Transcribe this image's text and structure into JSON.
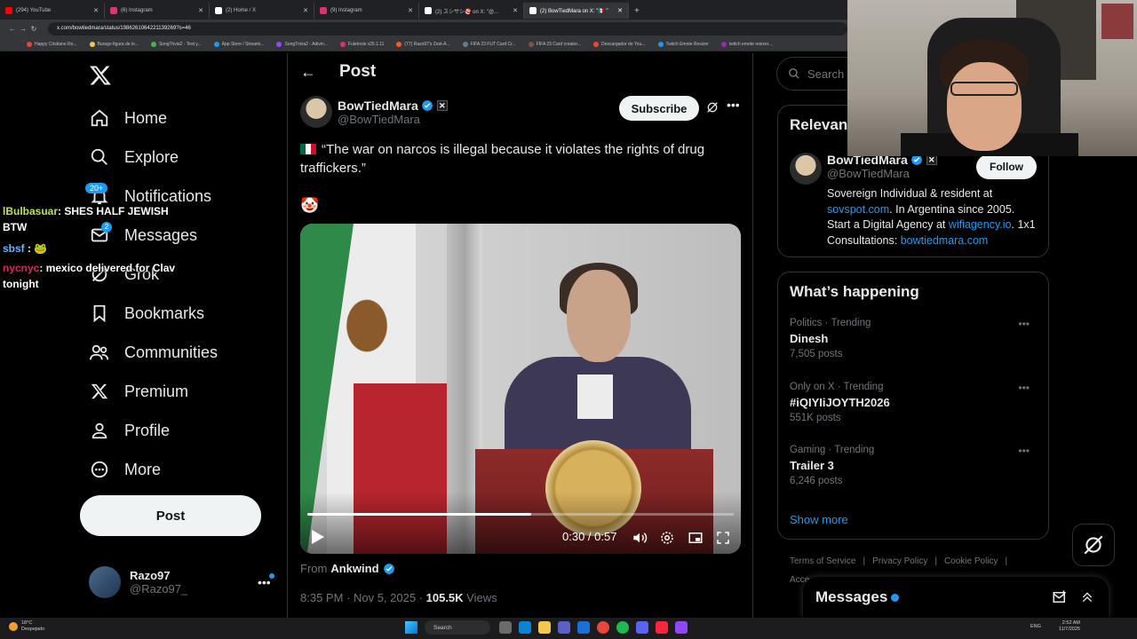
{
  "browser": {
    "tabs": [
      {
        "label": "(294) YouTube",
        "color": "#ff0000"
      },
      {
        "label": "(6) Instagram",
        "color": "#e1306c"
      },
      {
        "label": "(2) Home / X",
        "color": "#ffffff"
      },
      {
        "label": "(9) Instagram",
        "color": "#e1306c"
      },
      {
        "label": "(2) スシサシ🍣 on X: \"@...",
        "color": "#ffffff"
      },
      {
        "label": "(2) BowTiedMara on X: \"🇲🇽 \"",
        "color": "#ffffff"
      }
    ],
    "url": "x.com/bowtiedmara/status/1986261064221139269?s=46",
    "bookmarks": [
      "Happy Cristiano Ro...",
      "Burago figura de lo...",
      "SongTrivia2 - Test y...",
      "App Store / Streami...",
      "SongTrivia2 - Adivin...",
      "Fuletools v25.1.11",
      "(77) Razo97's Zest-A...",
      "FIFA 23 FUT Card Cr...",
      "FIFA 23 Card creator...",
      "Descargador de You...",
      "Twitch Emote Resizer",
      "twitch emote resizer..."
    ]
  },
  "nav": {
    "items": [
      {
        "label": "Home",
        "icon": "home-icon"
      },
      {
        "label": "Explore",
        "icon": "search-icon"
      },
      {
        "label": "Notifications",
        "icon": "bell-icon"
      },
      {
        "label": "Messages",
        "icon": "mail-icon"
      },
      {
        "label": "Grok",
        "icon": "grok-icon"
      },
      {
        "label": "Bookmarks",
        "icon": "bookmark-icon"
      },
      {
        "label": "Communities",
        "icon": "communities-icon"
      },
      {
        "label": "Premium",
        "icon": "x-icon"
      },
      {
        "label": "Profile",
        "icon": "person-icon"
      },
      {
        "label": "More",
        "icon": "more-circle-icon"
      }
    ],
    "notifications_badge": "20+",
    "messages_badge": "2",
    "post_label": "Post",
    "account": {
      "name": "Razo97",
      "handle": "@Razo97_"
    }
  },
  "chat": [
    {
      "user": "lBulbasuar",
      "text": ": SHES HALF JEWISH BTW"
    },
    {
      "user": "sbsf",
      "text": ":"
    },
    {
      "user": "nycnyc",
      "text": ": mexico delivered for Clav tonight"
    }
  ],
  "post": {
    "header_title": "Post",
    "author_name": "BowTiedMara",
    "author_handle": "@BowTiedMara",
    "subscribe_label": "Subscribe",
    "text": "“The war on narcos is illegal because it violates the rights of drug traffickers.”",
    "emoji": "🤡",
    "video": {
      "time": "0:30 / 0:57",
      "progress": 0.526
    },
    "from_label": "From",
    "from_source": "Ankwind",
    "timestamp": "8:35 PM · Nov 5, 2025 · ",
    "views_count": "105.5K",
    "views_label": " Views"
  },
  "right": {
    "search_placeholder": "Search",
    "relevant_title": "Relevant people",
    "relevant": {
      "name": "BowTiedMara",
      "handle": "@BowTiedMara",
      "follow_label": "Follow",
      "bio_1": "Sovereign Individual & resident at ",
      "bio_link1": "sovspot.com",
      "bio_2": ". In Argentina since 2005. Start a Digital Agency at ",
      "bio_link2": "wifiagency.io",
      "bio_3": ". 1x1 Consultations: ",
      "bio_link3": "bowtiedmara.com"
    },
    "happening_title": "What’s happening",
    "trends": [
      {
        "meta": "Politics · Trending",
        "name": "Dinesh",
        "count": "7,505 posts"
      },
      {
        "meta": "Only on X · Trending",
        "name": "#iQIYIiJOYTH2026",
        "count": "551K posts"
      },
      {
        "meta": "Gaming · Trending",
        "name": "Trailer 3",
        "count": "6,246 posts"
      }
    ],
    "show_more": "Show more",
    "footer": [
      "Terms of Service",
      "Privacy Policy",
      "Cookie Policy",
      "Acce..."
    ],
    "messages_title": "Messages"
  },
  "taskbar": {
    "weather_temp": "18°C",
    "weather_desc": "Despejado",
    "search_label": "Search",
    "lang": "ENG",
    "time": "2:52 AM",
    "date": "11/7/2025"
  },
  "colors": {
    "accent": "#1d9bf0",
    "background": "#000000",
    "text": "#e7e9ea",
    "muted": "#71767b"
  }
}
